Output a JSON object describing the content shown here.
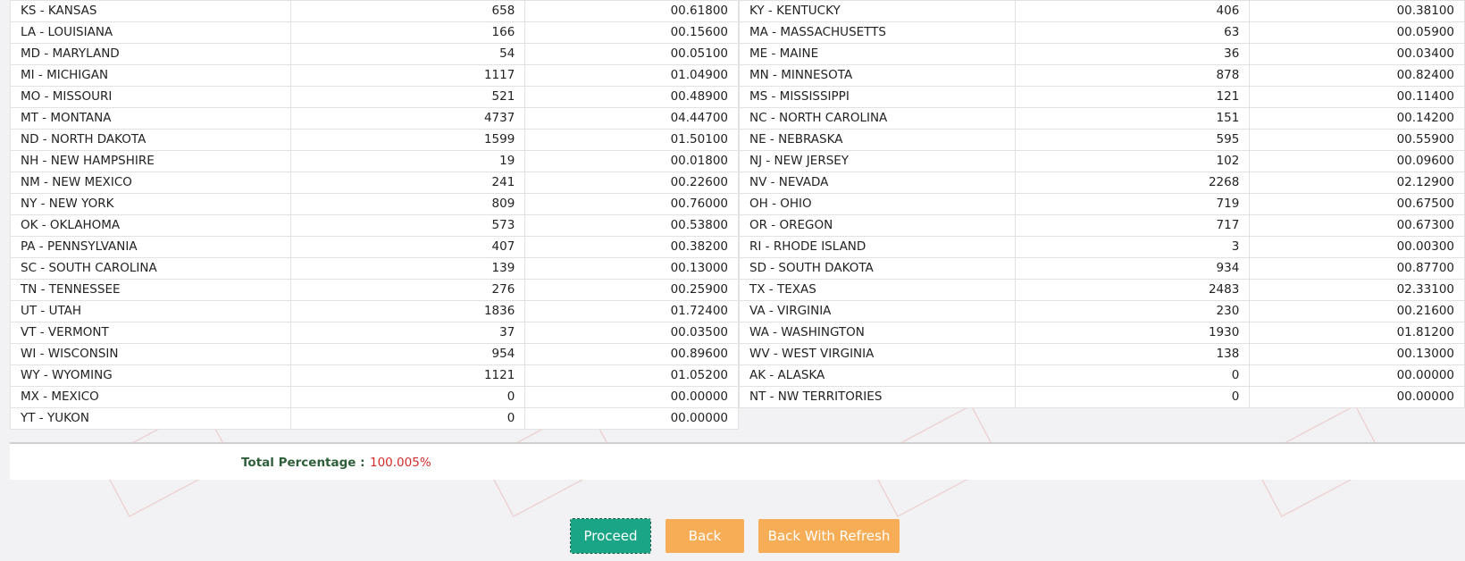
{
  "left_rows": [
    {
      "state": "KS - KANSAS",
      "count": "658",
      "percent": "00.61800"
    },
    {
      "state": "LA - LOUISIANA",
      "count": "166",
      "percent": "00.15600"
    },
    {
      "state": "MD - MARYLAND",
      "count": "54",
      "percent": "00.05100"
    },
    {
      "state": "MI - MICHIGAN",
      "count": "1117",
      "percent": "01.04900"
    },
    {
      "state": "MO - MISSOURI",
      "count": "521",
      "percent": "00.48900"
    },
    {
      "state": "MT - MONTANA",
      "count": "4737",
      "percent": "04.44700"
    },
    {
      "state": "ND - NORTH DAKOTA",
      "count": "1599",
      "percent": "01.50100"
    },
    {
      "state": "NH - NEW HAMPSHIRE",
      "count": "19",
      "percent": "00.01800"
    },
    {
      "state": "NM - NEW MEXICO",
      "count": "241",
      "percent": "00.22600"
    },
    {
      "state": "NY - NEW YORK",
      "count": "809",
      "percent": "00.76000"
    },
    {
      "state": "OK - OKLAHOMA",
      "count": "573",
      "percent": "00.53800"
    },
    {
      "state": "PA - PENNSYLVANIA",
      "count": "407",
      "percent": "00.38200"
    },
    {
      "state": "SC - SOUTH CAROLINA",
      "count": "139",
      "percent": "00.13000"
    },
    {
      "state": "TN - TENNESSEE",
      "count": "276",
      "percent": "00.25900"
    },
    {
      "state": "UT - UTAH",
      "count": "1836",
      "percent": "01.72400"
    },
    {
      "state": "VT - VERMONT",
      "count": "37",
      "percent": "00.03500"
    },
    {
      "state": "WI - WISCONSIN",
      "count": "954",
      "percent": "00.89600"
    },
    {
      "state": "WY - WYOMING",
      "count": "1121",
      "percent": "01.05200"
    },
    {
      "state": "MX - MEXICO",
      "count": "0",
      "percent": "00.00000"
    },
    {
      "state": "YT - YUKON",
      "count": "0",
      "percent": "00.00000"
    }
  ],
  "right_rows": [
    {
      "state": "KY - KENTUCKY",
      "count": "406",
      "percent": "00.38100"
    },
    {
      "state": "MA - MASSACHUSETTS",
      "count": "63",
      "percent": "00.05900"
    },
    {
      "state": "ME - MAINE",
      "count": "36",
      "percent": "00.03400"
    },
    {
      "state": "MN - MINNESOTA",
      "count": "878",
      "percent": "00.82400"
    },
    {
      "state": "MS - MISSISSIPPI",
      "count": "121",
      "percent": "00.11400"
    },
    {
      "state": "NC - NORTH CAROLINA",
      "count": "151",
      "percent": "00.14200"
    },
    {
      "state": "NE - NEBRASKA",
      "count": "595",
      "percent": "00.55900"
    },
    {
      "state": "NJ - NEW JERSEY",
      "count": "102",
      "percent": "00.09600"
    },
    {
      "state": "NV - NEVADA",
      "count": "2268",
      "percent": "02.12900"
    },
    {
      "state": "OH - OHIO",
      "count": "719",
      "percent": "00.67500"
    },
    {
      "state": "OR - OREGON",
      "count": "717",
      "percent": "00.67300"
    },
    {
      "state": "RI - RHODE ISLAND",
      "count": "3",
      "percent": "00.00300"
    },
    {
      "state": "SD - SOUTH DAKOTA",
      "count": "934",
      "percent": "00.87700"
    },
    {
      "state": "TX - TEXAS",
      "count": "2483",
      "percent": "02.33100"
    },
    {
      "state": "VA - VIRGINIA",
      "count": "230",
      "percent": "00.21600"
    },
    {
      "state": "WA - WASHINGTON",
      "count": "1930",
      "percent": "01.81200"
    },
    {
      "state": "WV - WEST VIRGINIA",
      "count": "138",
      "percent": "00.13000"
    },
    {
      "state": "AK - ALASKA",
      "count": "0",
      "percent": "00.00000"
    },
    {
      "state": "NT - NW TERRITORIES",
      "count": "0",
      "percent": "00.00000"
    }
  ],
  "total": {
    "label": "Total Percentage",
    "separator": ":",
    "value": "100.005%"
  },
  "buttons": {
    "proceed": "Proceed",
    "back": "Back",
    "back_refresh": "Back With Refresh"
  },
  "colors": {
    "proceed": "#1aa586",
    "back": "#f6ad55",
    "total_label": "#2e5e3a",
    "total_value": "#d22b2b",
    "page_bg": "#f2f1f3"
  }
}
